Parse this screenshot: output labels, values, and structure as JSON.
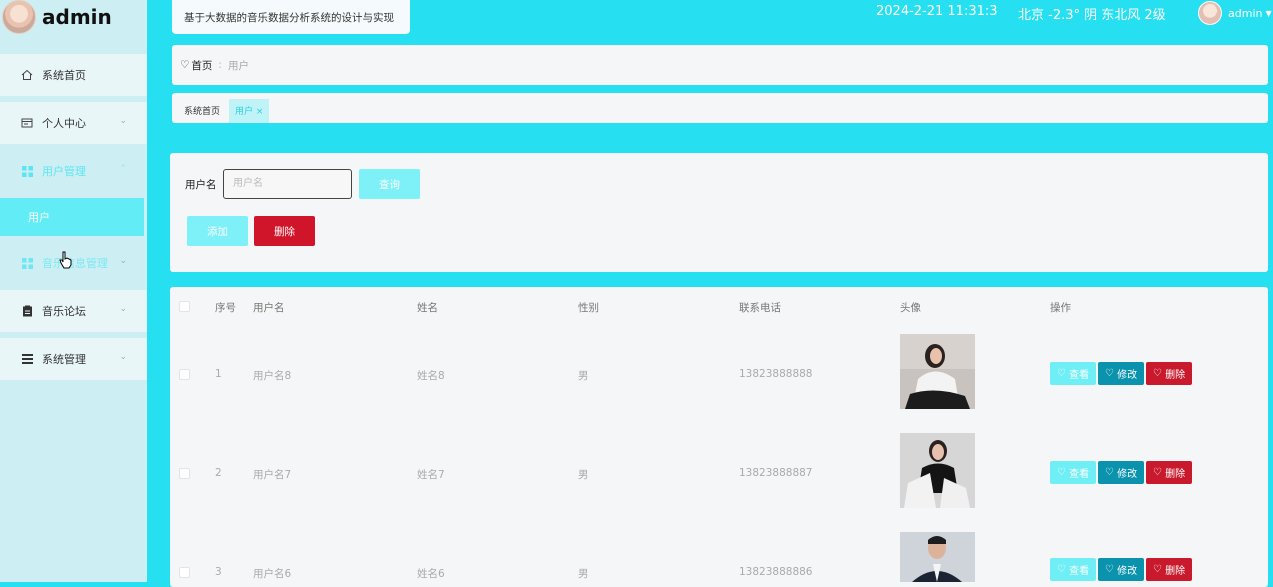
{
  "brand": {
    "name": "admin"
  },
  "header": {
    "title": "基于大数据的音乐数据分析系统的设计与实现",
    "datetime": "2024-2-21 11:31:3",
    "weather": "北京 -2.3° 阴 东北风 2级",
    "user": "admin"
  },
  "sidebar": {
    "items": [
      {
        "label": "系统首页",
        "icon": "home-icon"
      },
      {
        "label": "个人中心",
        "icon": "profile-icon"
      },
      {
        "label": "用户管理",
        "icon": "grid-icon"
      },
      {
        "label": "用户"
      },
      {
        "label": "音乐信息管理",
        "icon": "grid-icon"
      },
      {
        "label": "音乐论坛",
        "icon": "clipboard-icon"
      },
      {
        "label": "系统管理",
        "icon": "list-icon"
      }
    ]
  },
  "breadcrumb": {
    "home": "首页",
    "current": "用户"
  },
  "tabs": [
    {
      "label": "系统首页"
    },
    {
      "label": "用户"
    }
  ],
  "search": {
    "label": "用户名",
    "placeholder": "用户名",
    "query_button": "查询",
    "add_button": "添加",
    "delete_button": "删除"
  },
  "table": {
    "headers": [
      "序号",
      "用户名",
      "姓名",
      "性别",
      "联系电话",
      "头像",
      "操作"
    ],
    "rows": [
      {
        "no": "1",
        "username": "用户名8",
        "name": "姓名8",
        "gender": "男",
        "phone": "13823888888"
      },
      {
        "no": "2",
        "username": "用户名7",
        "name": "姓名7",
        "gender": "男",
        "phone": "13823888887"
      },
      {
        "no": "3",
        "username": "用户名6",
        "name": "姓名6",
        "gender": "男",
        "phone": "13823888886"
      }
    ],
    "actions": {
      "view": "查看",
      "edit": "修改",
      "delete": "删除"
    }
  },
  "colors": {
    "accent": "#26dff0",
    "danger": "#d0152b",
    "edit": "#0b93ad"
  }
}
